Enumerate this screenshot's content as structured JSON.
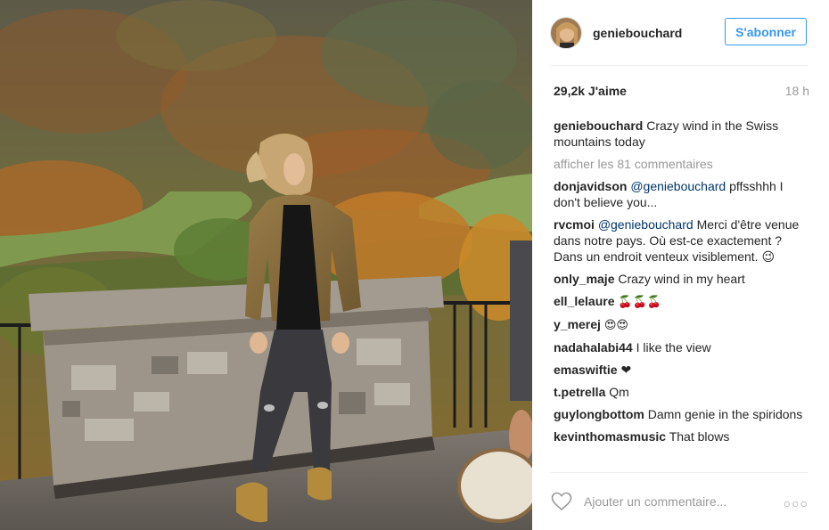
{
  "post": {
    "username": "geniebouchard",
    "follow_label": "S'abonner",
    "likes": "29,2k J'aime",
    "time_ago": "18 h"
  },
  "caption": {
    "user": "geniebouchard",
    "text": "Crazy wind in the Swiss mountains today"
  },
  "load_more": "afficher les 81 commentaires",
  "comments": [
    {
      "user": "donjavidson",
      "mention": "@geniebouchard",
      "text": "pffsshhh I don't believe you..."
    },
    {
      "user": "rvcmoi",
      "mention": "@geniebouchard",
      "text": "Merci d'être venue dans notre pays. Où est-ce exactement ? Dans un endroit venteux visiblement. 😉"
    },
    {
      "user": "only_maje",
      "mention": "",
      "text": "Crazy wind in my heart"
    },
    {
      "user": "ell_lelaure",
      "mention": "",
      "text": "🍒🍒🍒"
    },
    {
      "user": "y_merej",
      "mention": "",
      "text": "😍😍"
    },
    {
      "user": "nadahalabi44",
      "mention": "",
      "text": "I like the view"
    },
    {
      "user": "emaswiftie",
      "mention": "",
      "text": "❤"
    },
    {
      "user": "t.petrella",
      "mention": "",
      "text": "Qm"
    },
    {
      "user": "guylongbottom",
      "mention": "",
      "text": "Damn genie in the spiridons"
    },
    {
      "user": "kevinthomasmusic",
      "mention": "",
      "text": "That blows"
    }
  ],
  "footer": {
    "add_comment_placeholder": "Ajouter un commentaire...",
    "more_options": "○○○"
  },
  "icons": {
    "like": "heart-outline-icon",
    "more": "more-options-icon"
  },
  "colors": {
    "follow_blue": "#3897f0",
    "mention_blue": "#003569",
    "muted_gray": "#999999"
  }
}
